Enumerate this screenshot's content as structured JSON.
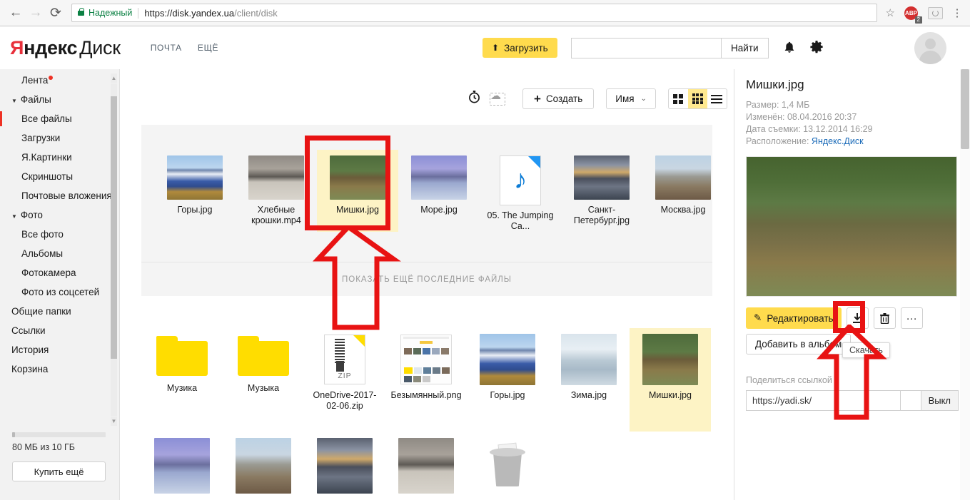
{
  "browser": {
    "back_icon": "←",
    "forward_icon": "→",
    "reload_icon": "⟳",
    "secure_label": "Надежный",
    "url_main": "https://disk.yandex.ua",
    "url_path": "/client/disk",
    "bookmark_icon": "☆",
    "extension_abp_label": "ABP",
    "extension_abp_badge": "2",
    "menu_icon": "⋮"
  },
  "header": {
    "logo_ya": "Я",
    "logo_ndex": "ндекс",
    "logo_disk": "Диск",
    "nav": [
      {
        "label": "ПОЧТА"
      },
      {
        "label": "ЕЩЁ"
      }
    ],
    "upload_label": "Загрузить",
    "upload_icon": "⬆",
    "search_value": "",
    "search_placeholder": "",
    "search_button": "Найти",
    "bell_icon": "🔔",
    "gear_icon": "⚙"
  },
  "sidebar": {
    "items": [
      {
        "label": "Лента",
        "level": "top",
        "badge": true
      },
      {
        "label": "Файлы",
        "level": "group"
      },
      {
        "label": "Все файлы",
        "level": "sub",
        "active": true
      },
      {
        "label": "Загрузки",
        "level": "sub"
      },
      {
        "label": "Я.Картинки",
        "level": "sub"
      },
      {
        "label": "Скриншоты",
        "level": "sub"
      },
      {
        "label": "Почтовые вложения",
        "level": "sub"
      },
      {
        "label": "Фото",
        "level": "group"
      },
      {
        "label": "Все фото",
        "level": "sub"
      },
      {
        "label": "Альбомы",
        "level": "sub"
      },
      {
        "label": "Фотокамера",
        "level": "sub"
      },
      {
        "label": "Фото из соцсетей",
        "level": "sub"
      },
      {
        "label": "Общие папки",
        "level": "top"
      },
      {
        "label": "Ссылки",
        "level": "top"
      },
      {
        "label": "История",
        "level": "top"
      },
      {
        "label": "Корзина",
        "level": "top"
      }
    ],
    "storage_text": "80 МБ из 10 ГБ",
    "buy_label": "Купить ещё"
  },
  "toolbar": {
    "timer_icon": "⏱",
    "cloud_upload_icon": "cloud-dashed",
    "create_label": "Создать",
    "create_plus": "+",
    "sort_label": "Имя",
    "sort_caret": "⌄",
    "view_tiles_label": "large-tiles",
    "view_grid_label": "small-tiles",
    "view_list_label": "list",
    "active_view": "small-tiles"
  },
  "recent": {
    "show_more_label": "Показать ещё последние файлы",
    "files": [
      {
        "name": "Горы.jpg",
        "kind": "image",
        "img": "mountains"
      },
      {
        "name": "Хлебные крошки.mp4",
        "kind": "video",
        "img": "geese"
      },
      {
        "name": "Мишки.jpg",
        "kind": "image",
        "img": "bears",
        "selected": true
      },
      {
        "name": "Море.jpg",
        "kind": "image",
        "img": "sea"
      },
      {
        "name": "05. The Jumping Ca...",
        "kind": "audio"
      },
      {
        "name": "Санкт-Петербург.jpg",
        "kind": "image",
        "img": "bridge"
      },
      {
        "name": "Москва.jpg",
        "kind": "image",
        "img": "moscow"
      }
    ]
  },
  "files": {
    "row2": [
      {
        "name": "Музика",
        "kind": "folder"
      },
      {
        "name": "Музыка",
        "kind": "folder"
      },
      {
        "name": "OneDrive-2017-02-06.zip",
        "kind": "zip",
        "zip_label": "ZIP"
      },
      {
        "name": "Безымянный.png",
        "kind": "image",
        "img": "screenshot"
      },
      {
        "name": "Горы.jpg",
        "kind": "image",
        "img": "mountains"
      },
      {
        "name": "Зима.jpg",
        "kind": "image",
        "img": "winter"
      },
      {
        "name": "Мишки.jpg",
        "kind": "image",
        "img": "bears",
        "selected": true
      }
    ],
    "row3": [
      {
        "name": "",
        "kind": "image",
        "img": "sea"
      },
      {
        "name": "",
        "kind": "image",
        "img": "moscow"
      },
      {
        "name": "",
        "kind": "image",
        "img": "bridge"
      },
      {
        "name": "",
        "kind": "video",
        "img": "geese"
      },
      {
        "name": "",
        "kind": "trash"
      }
    ]
  },
  "detail": {
    "title": "Мишки.jpg",
    "size_line": "Размер: 1,4 МБ",
    "modified_line": "Изменён: 08.04.2016 20:37",
    "shot_line": "Дата съемки: 13.12.2014 16:29",
    "location_label": "Расположение: ",
    "location_value": "Яндекс.Диск",
    "edit_label": "Редактировать",
    "edit_icon": "✎",
    "download_icon": "⬇",
    "delete_icon": "🗑",
    "more_icon": "···",
    "album_label": "Добавить в альбом",
    "tooltip_label": "Скачать",
    "share_label": "Поделиться ссылкой",
    "share_url": "https://yadi.sk/",
    "share_toggle_label": "Выкл"
  },
  "colors": {
    "accent_yellow": "#ffdb4d",
    "selection_yellow": "#fdf3c5",
    "annotation_red": "#e81313",
    "secure_green": "#0b8043",
    "link_blue": "#1a6ab8"
  }
}
